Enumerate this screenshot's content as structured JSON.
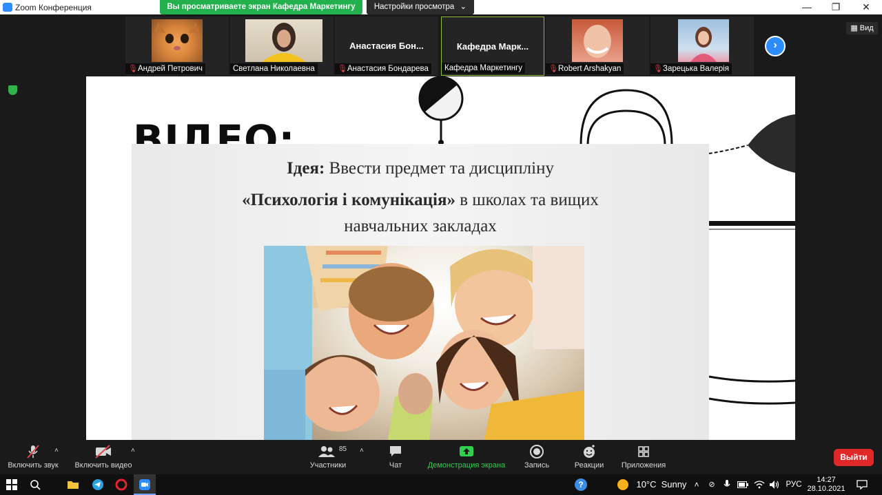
{
  "titlebar": {
    "app_title": "Zoom Конференция",
    "share_banner": "Вы просматриваете экран Кафедра Маркетингу",
    "view_settings": "Настройки просмотра",
    "minimize_glyph": "—",
    "maximize_glyph": "❐",
    "close_glyph": "✕",
    "view_settings_caret": "⌄"
  },
  "participants": [
    {
      "name": "Андрей Петрович",
      "muted": true,
      "video": "cat-photo"
    },
    {
      "name": "Светлана Николаевна",
      "muted": false,
      "video": "woman-yellow-photo"
    },
    {
      "name": "Анастасия Бондарева",
      "muted": true,
      "display": "Анастасия Бон..."
    },
    {
      "name": "Кафедра Маркетингу",
      "muted": false,
      "display": "Кафедра Марк...",
      "active": true
    },
    {
      "name": "Robert Arshakyan",
      "muted": true,
      "video": "smiling-woman-photo"
    },
    {
      "name": "Зарецька Валерія",
      "muted": true,
      "video": "girl-photo"
    }
  ],
  "view_button": "Вид",
  "next_page_glyph": "›",
  "slide": {
    "heading": "ВІДЕО:",
    "idea_label": "Ідея:",
    "idea_line1_rest": " Ввести предмет та дисципліну",
    "line2_bold": "«Психологія і комунікація»",
    "line2_rest": " в школах та вищих",
    "line3": "навчальних закладах"
  },
  "toolbar": {
    "audio": {
      "label": "Включить звук",
      "icon": "mic-muted-icon"
    },
    "video": {
      "label": "Включить видео",
      "icon": "camera-off-icon"
    },
    "participants": {
      "label": "Участники",
      "count": "85",
      "icon": "participants-icon"
    },
    "chat": {
      "label": "Чат",
      "icon": "chat-icon"
    },
    "share": {
      "label": "Демонстрация экрана",
      "icon": "share-screen-icon",
      "color": "#2fd04b"
    },
    "record": {
      "label": "Запись",
      "icon": "record-icon"
    },
    "reactions": {
      "label": "Реакции",
      "icon": "reaction-icon"
    },
    "apps": {
      "label": "Приложения",
      "icon": "apps-icon"
    },
    "leave": {
      "label": "Выйти",
      "color": "#e02828"
    },
    "caret_glyph": "˄"
  },
  "taskbar": {
    "help_glyph": "?",
    "weather_temp": "10°C",
    "weather_text": "Sunny",
    "language": "РУС",
    "time": "14:27",
    "date": "28.10.2021"
  }
}
